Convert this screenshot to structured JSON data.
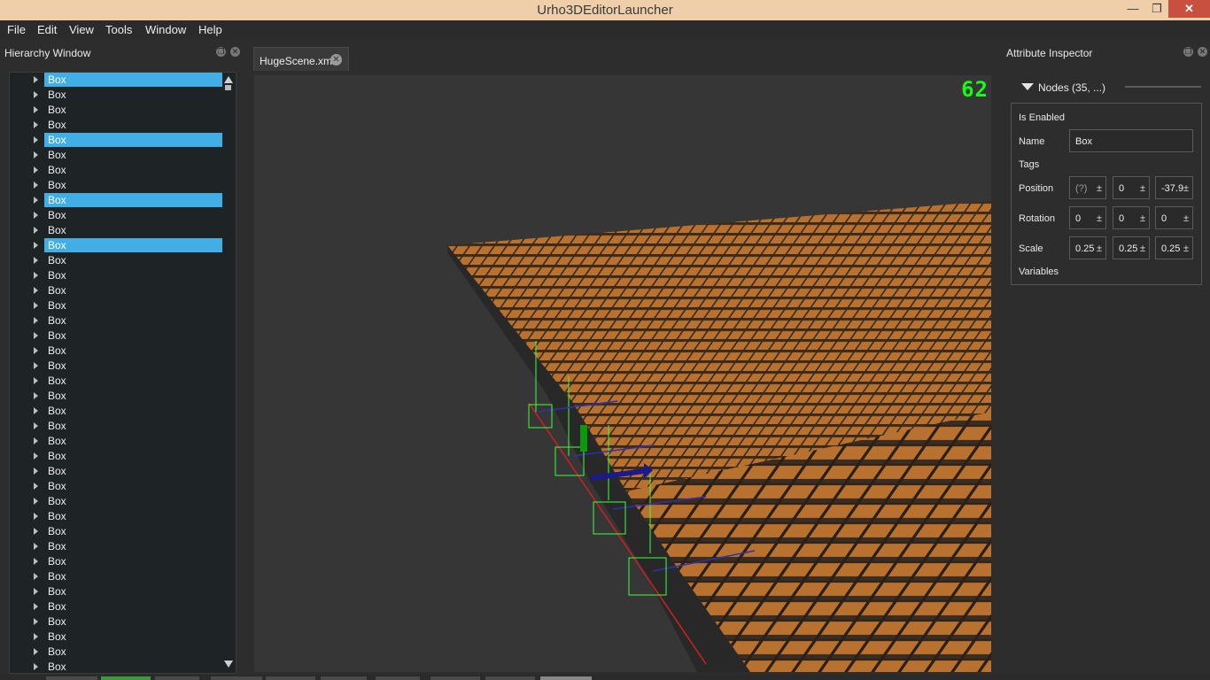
{
  "app": {
    "title": "Urho3DEditorLauncher"
  },
  "window_controls": {
    "minimize": "—",
    "maximize": "❐",
    "close": "✕"
  },
  "menu": [
    "File",
    "Edit",
    "View",
    "Tools",
    "Window",
    "Help"
  ],
  "hierarchy": {
    "title": "Hierarchy Window",
    "items": [
      {
        "label": "Box",
        "selected": true
      },
      {
        "label": "Box",
        "selected": false
      },
      {
        "label": "Box",
        "selected": false
      },
      {
        "label": "Box",
        "selected": false
      },
      {
        "label": "Box",
        "selected": true
      },
      {
        "label": "Box",
        "selected": false
      },
      {
        "label": "Box",
        "selected": false
      },
      {
        "label": "Box",
        "selected": false
      },
      {
        "label": "Box",
        "selected": true
      },
      {
        "label": "Box",
        "selected": false
      },
      {
        "label": "Box",
        "selected": false
      },
      {
        "label": "Box",
        "selected": true
      },
      {
        "label": "Box",
        "selected": false
      },
      {
        "label": "Box",
        "selected": false
      },
      {
        "label": "Box",
        "selected": false
      },
      {
        "label": "Box",
        "selected": false
      },
      {
        "label": "Box",
        "selected": false
      },
      {
        "label": "Box",
        "selected": false
      },
      {
        "label": "Box",
        "selected": false
      },
      {
        "label": "Box",
        "selected": false
      },
      {
        "label": "Box",
        "selected": false
      },
      {
        "label": "Box",
        "selected": false
      },
      {
        "label": "Box",
        "selected": false
      },
      {
        "label": "Box",
        "selected": false
      },
      {
        "label": "Box",
        "selected": false
      },
      {
        "label": "Box",
        "selected": false
      },
      {
        "label": "Box",
        "selected": false
      },
      {
        "label": "Box",
        "selected": false
      },
      {
        "label": "Box",
        "selected": false
      },
      {
        "label": "Box",
        "selected": false
      },
      {
        "label": "Box",
        "selected": false
      },
      {
        "label": "Box",
        "selected": false
      },
      {
        "label": "Box",
        "selected": false
      },
      {
        "label": "Box",
        "selected": false
      },
      {
        "label": "Box",
        "selected": false
      },
      {
        "label": "Box",
        "selected": false
      },
      {
        "label": "Box",
        "selected": false
      },
      {
        "label": "Box",
        "selected": false
      },
      {
        "label": "Box",
        "selected": false
      },
      {
        "label": "Box",
        "selected": false
      }
    ]
  },
  "scene_tab": {
    "label": "HugeScene.xml"
  },
  "viewport": {
    "fps": "62"
  },
  "inspector": {
    "title": "Attribute Inspector",
    "header": "Nodes (35, ...)",
    "is_enabled": "Is Enabled",
    "name_label": "Name",
    "name_value": "Box",
    "tags": "Tags",
    "position_label": "Position",
    "position": [
      "(?)",
      "0",
      "-37.9"
    ],
    "rotation_label": "Rotation",
    "rotation": [
      "0",
      "0",
      "0"
    ],
    "scale_label": "Scale",
    "scale": [
      "0.25",
      "0.25",
      "0.25"
    ],
    "plusminus": "±",
    "variables": "Variables"
  },
  "colors": {
    "selection": "#41aee6",
    "titlebar": "#efcfa9",
    "close": "#c7503e",
    "fps": "#15ff15",
    "box_top": "#b8712f"
  }
}
